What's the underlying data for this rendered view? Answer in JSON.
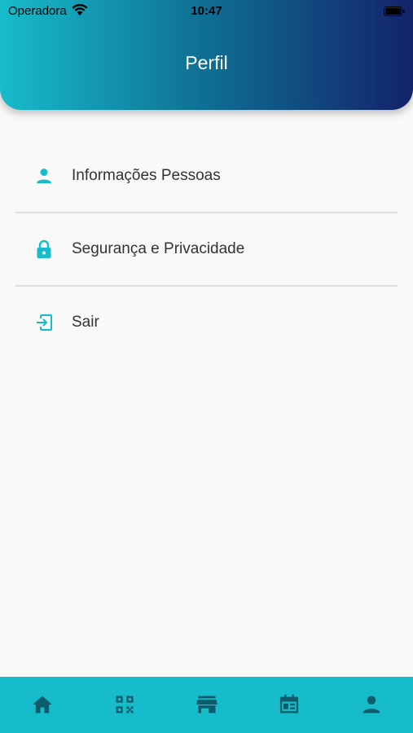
{
  "status_bar": {
    "carrier": "Operadora",
    "time": "10:47"
  },
  "header": {
    "title": "Perfil"
  },
  "menu": {
    "items": [
      {
        "label": "Informações Pessoas",
        "icon": "person-icon"
      },
      {
        "label": "Segurança e Privacidade",
        "icon": "lock-icon"
      },
      {
        "label": "Sair",
        "icon": "logout-icon"
      }
    ]
  },
  "nav": {
    "items": [
      {
        "icon": "home-icon"
      },
      {
        "icon": "qr-code-icon"
      },
      {
        "icon": "store-icon"
      },
      {
        "icon": "calendar-icon"
      },
      {
        "icon": "person-icon",
        "active": true
      }
    ]
  },
  "colors": {
    "accent": "#17bccb",
    "gradient_end": "#13236a",
    "nav_icon": "#0d5c6b"
  }
}
